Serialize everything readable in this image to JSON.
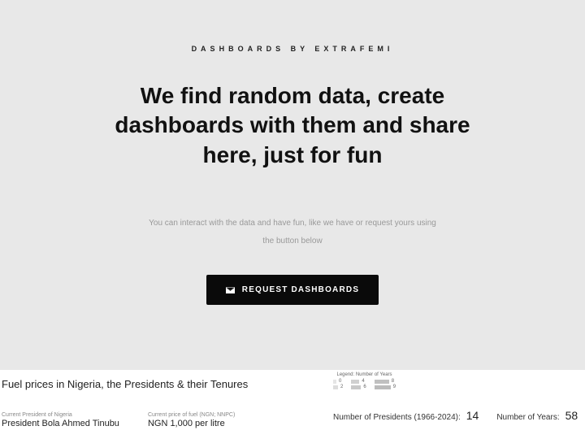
{
  "hero": {
    "eyebrow": "DASHBOARDS BY EXTRAFEMI",
    "headline": "We find random data, create dashboards with them and share here, just for fun",
    "subhead": "You can interact with the data and have fun, like we have or request yours using the button below",
    "cta_label": "REQUEST DASHBOARDS"
  },
  "dashboard": {
    "title": "Fuel prices in Nigeria, the Presidents & their Tenures",
    "current_president_label": "Current President of Nigeria",
    "current_president_value": "President Bola Ahmed Tinubu",
    "current_fuel_label": "Current price of fuel (NGN; NNPC)",
    "current_fuel_value": "NGN 1,000 per litre",
    "legend_title": "Legend: Number of Years",
    "legend_items": [
      "0",
      "4",
      "8",
      "2",
      "6",
      "9"
    ],
    "kpi1_label": "Number of Presidents (1966-2024):",
    "kpi1_value": "14",
    "kpi2_label": "Number of Years:",
    "kpi2_value": "58"
  }
}
